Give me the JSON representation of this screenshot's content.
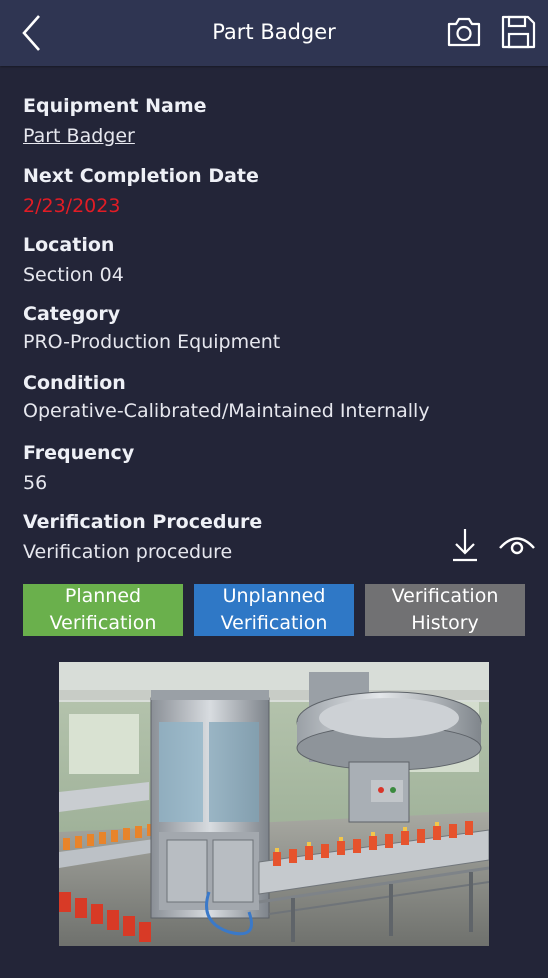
{
  "header": {
    "title": "Part Badger",
    "icons": {
      "back": "chevron-left-icon",
      "camera": "camera-icon",
      "save": "save-icon"
    }
  },
  "fields": {
    "equipment_name": {
      "label": "Equipment Name",
      "value": "Part Badger"
    },
    "next_completion_date": {
      "label": "Next Completion Date",
      "value": "2/23/2023"
    },
    "location": {
      "label": "Location",
      "value": "Section 04"
    },
    "category": {
      "label": "Category",
      "value": "PRO-Production Equipment"
    },
    "condition": {
      "label": "Condition",
      "value": "Operative-Calibrated/Maintained Internally"
    },
    "frequency": {
      "label": "Frequency",
      "value": "56"
    },
    "verification_procedure": {
      "label": "Verification Procedure",
      "value": "Verification procedure"
    }
  },
  "procedure_icons": {
    "download": "download-icon",
    "view": "eye-icon"
  },
  "buttons": {
    "planned": "Planned Verification",
    "unplanned": "Unplanned Verification",
    "history": "Verification History"
  },
  "colors": {
    "background": "#232538",
    "header": "#2f3552",
    "date_red": "#e21c25",
    "planned_green": "#6ab04c",
    "unplanned_blue": "#2f78c6",
    "history_gray": "#717173"
  }
}
